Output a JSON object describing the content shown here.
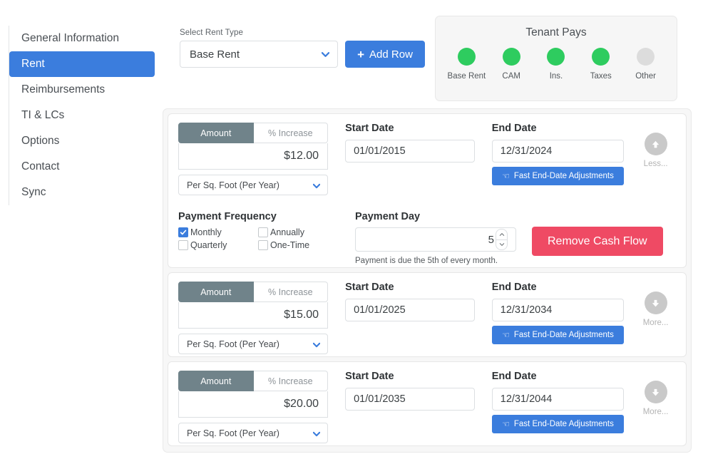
{
  "sidebar": {
    "items": [
      {
        "label": "General Information",
        "active": false
      },
      {
        "label": "Rent",
        "active": true
      },
      {
        "label": "Reimbursements",
        "active": false
      },
      {
        "label": "TI & LCs",
        "active": false
      },
      {
        "label": "Options",
        "active": false
      },
      {
        "label": "Contact",
        "active": false
      },
      {
        "label": "Sync",
        "active": false
      }
    ]
  },
  "toolbar": {
    "rent_type_label": "Select Rent Type",
    "rent_type_value": "Base Rent",
    "add_row_label": "Add Row",
    "plus_icon": "+"
  },
  "tenant_pays": {
    "title": "Tenant Pays",
    "active_color": "#2ecc5f",
    "inactive_color": "#dcdcdc",
    "items": [
      {
        "label": "Base Rent",
        "active": true
      },
      {
        "label": "CAM",
        "active": true
      },
      {
        "label": "Ins.",
        "active": true
      },
      {
        "label": "Taxes",
        "active": true
      },
      {
        "label": "Other",
        "active": false
      }
    ]
  },
  "labels": {
    "amount_toggle": "Amount",
    "percent_toggle": "% Increase",
    "start_date": "Start Date",
    "end_date": "End Date",
    "fast_adjust": "Fast End-Date Adjustments",
    "payment_frequency": "Payment Frequency",
    "payment_day": "Payment Day",
    "remove_cash_flow": "Remove Cash Flow",
    "less": "Less...",
    "more": "More..."
  },
  "colors": {
    "accent_blue": "#3b7ddd",
    "toggle_active": "#70838a",
    "danger_pink": "#ef4a64",
    "status_green": "#2ecc5f"
  },
  "cash_flows": [
    {
      "mode": "Amount",
      "amount": "$12.00",
      "unit": "Per Sq. Foot (Per Year)",
      "start_date": "01/01/2015",
      "end_date": "12/31/2024",
      "expanded": true,
      "expand_label": "Less...",
      "payment_frequency": [
        {
          "label": "Monthly",
          "checked": true
        },
        {
          "label": "Annually",
          "checked": false
        },
        {
          "label": "Quarterly",
          "checked": false
        },
        {
          "label": "One-Time",
          "checked": false
        }
      ],
      "payment_day": "5",
      "payment_note": "Payment is due the 5th of every month."
    },
    {
      "mode": "Amount",
      "amount": "$15.00",
      "unit": "Per Sq. Foot (Per Year)",
      "start_date": "01/01/2025",
      "end_date": "12/31/2034",
      "expanded": false,
      "expand_label": "More..."
    },
    {
      "mode": "Amount",
      "amount": "$20.00",
      "unit": "Per Sq. Foot (Per Year)",
      "start_date": "01/01/2035",
      "end_date": "12/31/2044",
      "expanded": false,
      "expand_label": "More..."
    }
  ]
}
